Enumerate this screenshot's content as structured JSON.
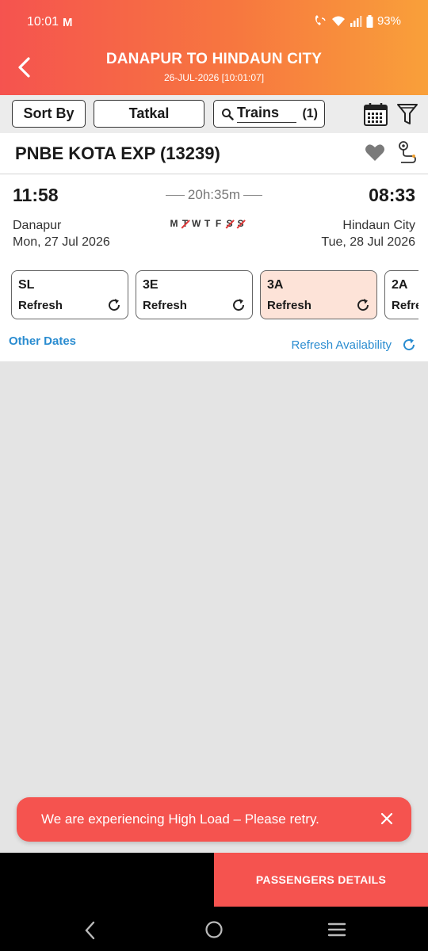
{
  "status_bar": {
    "time": "10:01",
    "notification_icon": "gmail-icon",
    "battery": "93%"
  },
  "header": {
    "title": "DANAPUR TO HINDAUN CITY",
    "subtitle": "26-JUL-2026 [10:01:07]"
  },
  "filters": {
    "sort_label": "Sort By",
    "quota_label": "Tatkal",
    "trains_label": "Trains",
    "trains_count": "(1)"
  },
  "train": {
    "name": "PNBE KOTA EXP (13239)",
    "departure_time": "11:58",
    "arrival_time": "08:33",
    "duration": "20h:35m",
    "source": "Danapur",
    "source_date": "Mon, 27 Jul 2026",
    "destination": "Hindaun City",
    "destination_date": "Tue, 28 Jul 2026",
    "days": [
      {
        "label": "M",
        "runs": true
      },
      {
        "label": "T",
        "runs": false
      },
      {
        "label": "W",
        "runs": true
      },
      {
        "label": "T",
        "runs": true
      },
      {
        "label": "F",
        "runs": true
      },
      {
        "label": "S",
        "runs": false
      },
      {
        "label": "S",
        "runs": false
      }
    ],
    "classes": [
      {
        "code": "SL",
        "status": "Refresh",
        "selected": false
      },
      {
        "code": "3E",
        "status": "Refresh",
        "selected": false
      },
      {
        "code": "3A",
        "status": "Refresh",
        "selected": true
      },
      {
        "code": "2A",
        "status": "Refresh",
        "selected": false
      }
    ],
    "other_dates_label": "Other Dates",
    "refresh_availability_label": "Refresh Availability"
  },
  "toast": {
    "message": "We are experiencing High Load – Please retry."
  },
  "footer": {
    "passengers_button": "PASSENGERS DETAILS"
  },
  "colors": {
    "accent": "#f5534f",
    "header_end": "#f9a03a",
    "link": "#2a8cd0",
    "selected_class": "#fde3d8"
  }
}
